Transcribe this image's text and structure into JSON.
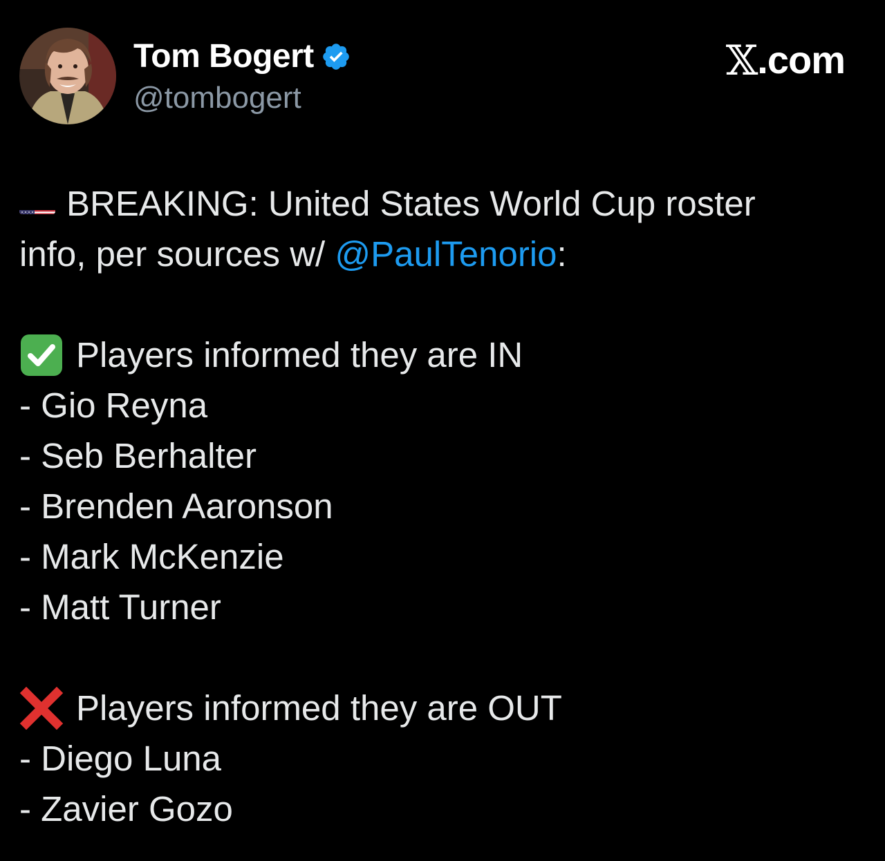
{
  "author": {
    "display_name": "Tom Bogert",
    "handle": "@tombogert",
    "verified": true
  },
  "brand": {
    "x_mark": "𝕏",
    "suffix": ".com"
  },
  "tweet": {
    "headline_prefix": "BREAKING: United States World Cup roster",
    "line2_prefix": "info, per sources w/ ",
    "mention": "@PaulTenorio",
    "line2_suffix": ":",
    "in_section": {
      "title": "Players informed they are IN",
      "players": [
        "- Gio Reyna",
        "- Seb Berhalter",
        "- Brenden Aaronson",
        "- Mark McKenzie",
        "- Matt Turner"
      ]
    },
    "out_section": {
      "title": "Players informed they are OUT",
      "players": [
        "- Diego Luna",
        "- Zavier Gozo"
      ]
    }
  },
  "icons": {
    "flag": "us-flag-icon",
    "in": "check-mark-icon",
    "out": "cross-mark-icon",
    "verified": "verified-badge-icon"
  },
  "colors": {
    "background": "#000000",
    "text": "#e7e9ea",
    "secondary": "#8b98a5",
    "link": "#1d9bf0",
    "verified": "#1d9bf0",
    "check_green": "#4caf50",
    "cross_red": "#e0312f"
  }
}
